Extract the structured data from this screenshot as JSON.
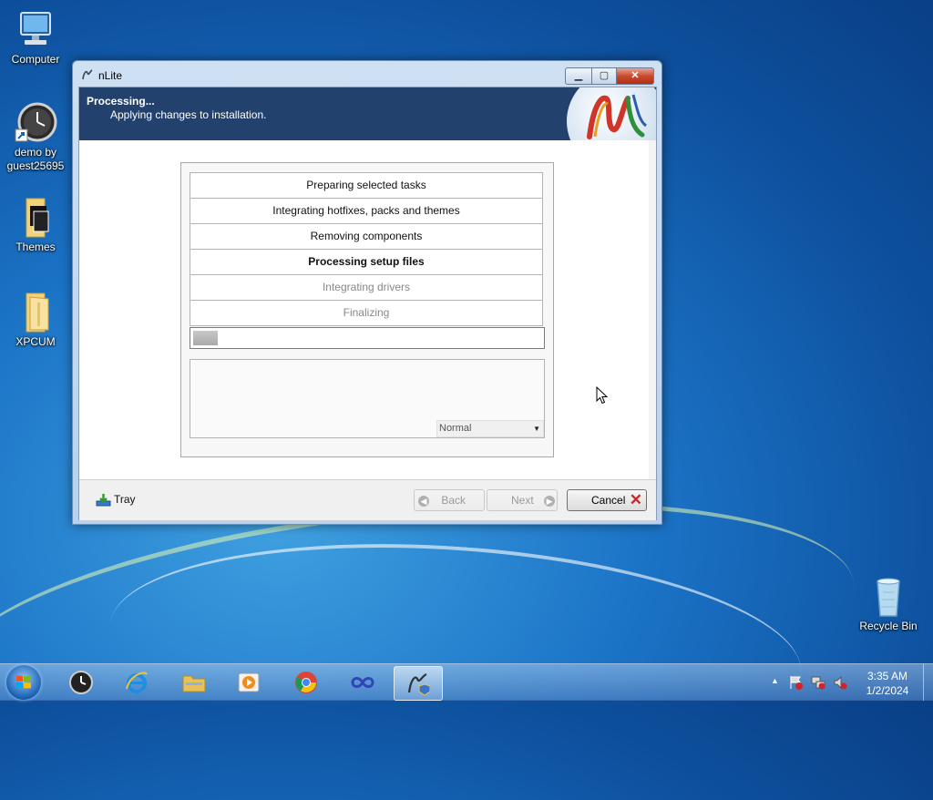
{
  "desktop": {
    "icons": [
      {
        "label": "Computer"
      },
      {
        "label": "demo by guest25695"
      },
      {
        "label": "Themes"
      },
      {
        "label": "XPCUM"
      },
      {
        "label": "Recycle Bin"
      }
    ]
  },
  "window": {
    "title": "nLite",
    "header": {
      "title": "Processing...",
      "subtitle": "Applying changes to installation."
    },
    "tasks": [
      {
        "label": "Preparing selected tasks",
        "state": "done"
      },
      {
        "label": "Integrating hotfixes, packs and themes",
        "state": "done"
      },
      {
        "label": "Removing components",
        "state": "done"
      },
      {
        "label": "Processing setup files",
        "state": "current"
      },
      {
        "label": "Integrating drivers",
        "state": "pending"
      },
      {
        "label": "Finalizing",
        "state": "pending"
      }
    ],
    "progress_fraction": 0.07,
    "log_level": {
      "selected": "Normal"
    },
    "footer": {
      "tray_label": "Tray",
      "back_label": "Back",
      "next_label": "Next",
      "cancel_label": "Cancel"
    }
  },
  "taskbar": {
    "clock_time": "3:35 AM",
    "clock_date": "1/2/2024"
  },
  "colors": {
    "header_bg": "#22416d",
    "cancel_x": "#d0242b"
  }
}
